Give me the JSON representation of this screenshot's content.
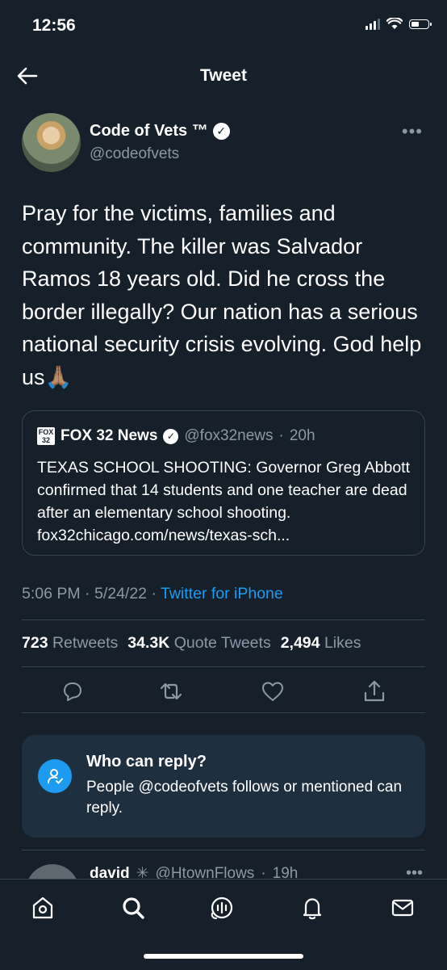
{
  "status_bar": {
    "time": "12:56"
  },
  "header": {
    "title": "Tweet"
  },
  "author": {
    "name": "Code of Vets ™",
    "handle": "@codeofvets"
  },
  "tweet": {
    "text": "Pray for the victims, families and community. The killer was Salvador Ramos 18 years old. Did he cross the border illegally? Our nation has a serious national security crisis evolving. God help us🙏🏽"
  },
  "quote": {
    "logo_text": "FOX 32",
    "name": "FOX 32 News",
    "handle": "@fox32news",
    "age": "20h",
    "text": "TEXAS SCHOOL SHOOTING: Governor Greg Abbott confirmed that 14 students and one teacher are dead after an elementary school shooting. fox32chicago.com/news/texas-sch..."
  },
  "timestamp": {
    "time": "5:06 PM",
    "date": "5/24/22",
    "source": "Twitter for iPhone"
  },
  "stats": {
    "retweets_count": "723",
    "retweets_label": "Retweets",
    "quotes_count": "34.3K",
    "quotes_label": "Quote Tweets",
    "likes_count": "2,494",
    "likes_label": "Likes"
  },
  "actions": [
    "reply-icon",
    "retweet-icon",
    "like-icon",
    "share-icon"
  ],
  "reply_settings": {
    "title": "Who can reply?",
    "description": "People @codeofvets follows or mentioned can reply."
  },
  "next_reply": {
    "name": "david",
    "handle": "@HtownFlows",
    "age": "19h"
  },
  "bottom_nav": [
    "home-icon",
    "search-icon",
    "spaces-icon",
    "notifications-icon",
    "messages-icon"
  ],
  "colors": {
    "background": "#15202b",
    "accent": "#1d9bf0",
    "secondary_text": "#8b98a5",
    "border": "#38444d"
  }
}
